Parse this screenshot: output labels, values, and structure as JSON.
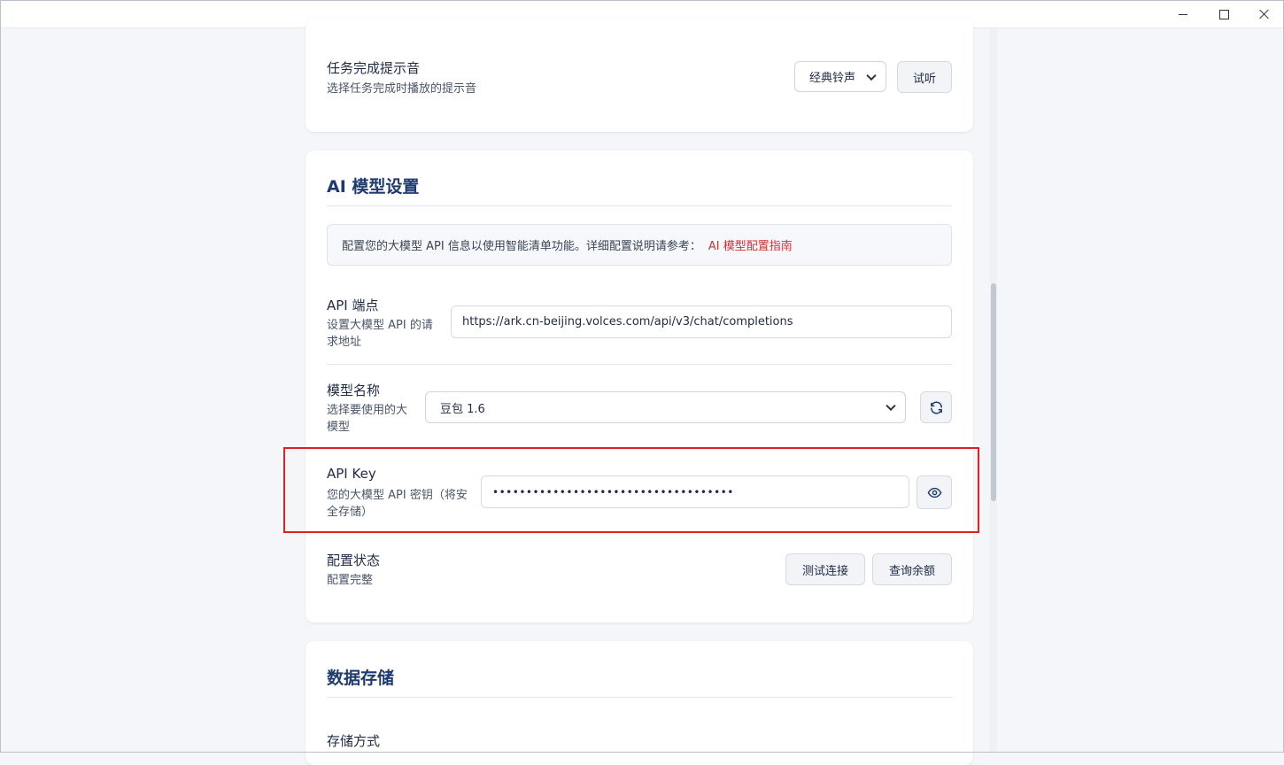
{
  "sound": {
    "title": "任务完成提示音",
    "desc": "选择任务完成时播放的提示音",
    "selected": "经典铃声",
    "preview_label": "试听"
  },
  "ai": {
    "section_title": "AI 模型设置",
    "info_text": "配置您的大模型 API 信息以使用智能清单功能。详细配置说明请参考：",
    "info_link": "AI 模型配置指南",
    "endpoint": {
      "title": "API 端点",
      "desc_line1": "设置大模型 API 的请",
      "desc_line2": "求地址",
      "value": "https://ark.cn-beijing.volces.com/api/v3/chat/completions"
    },
    "model": {
      "title": "模型名称",
      "desc_line1": "选择要使用的大",
      "desc_line2": "模型",
      "selected": "豆包 1.6"
    },
    "apikey": {
      "title": "API Key",
      "desc_line1": "您的大模型 API 密钥（将安",
      "desc_line2": "全存储）",
      "masked_value": "••••••••••••••••••••••••••••••••••••"
    },
    "status": {
      "title": "配置状态",
      "desc": "配置完整",
      "test_label": "测试连接",
      "balance_label": "查询余额"
    }
  },
  "storage": {
    "section_title": "数据存储",
    "method_title": "存储方式"
  },
  "icons": {
    "refresh": "refresh-icon",
    "eye": "eye-icon"
  },
  "colors": {
    "accent_title": "#1f3a6e",
    "link": "#d32f2f",
    "highlight": "#e02020"
  }
}
